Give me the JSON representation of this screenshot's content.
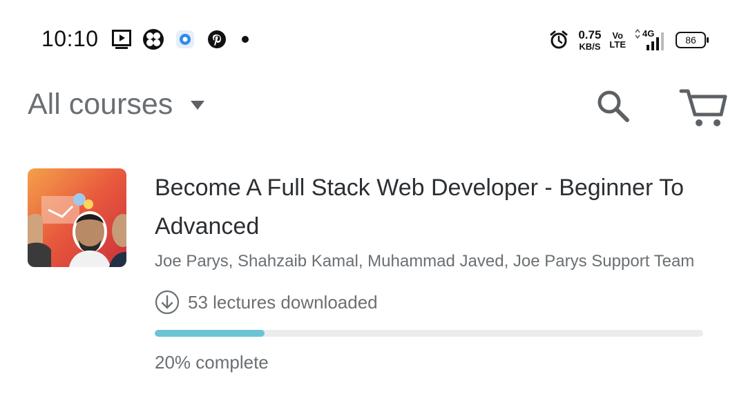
{
  "status_bar": {
    "time": "10:10",
    "app_icons": [
      "video-player-icon",
      "clover-app-icon",
      "browser-app-icon",
      "pinterest-icon"
    ],
    "net_speed_value": "0.75",
    "net_speed_unit": "KB/S",
    "volte_top": "Vo",
    "volte_bottom": "LTE",
    "network": "4G",
    "battery": "86"
  },
  "header": {
    "title": "All courses",
    "search_icon": "search-icon",
    "cart_icon": "cart-icon"
  },
  "course": {
    "title": "Become A Full Stack Web Developer - Beginner To Advanced",
    "authors": "Joe Parys, Shahzaib Kamal, Muhammad Javed, Joe Parys Support Team",
    "downloads": "53 lectures downloaded",
    "progress_percent": 20,
    "complete_label": "20% complete",
    "accent_color": "#6cc3d5"
  }
}
